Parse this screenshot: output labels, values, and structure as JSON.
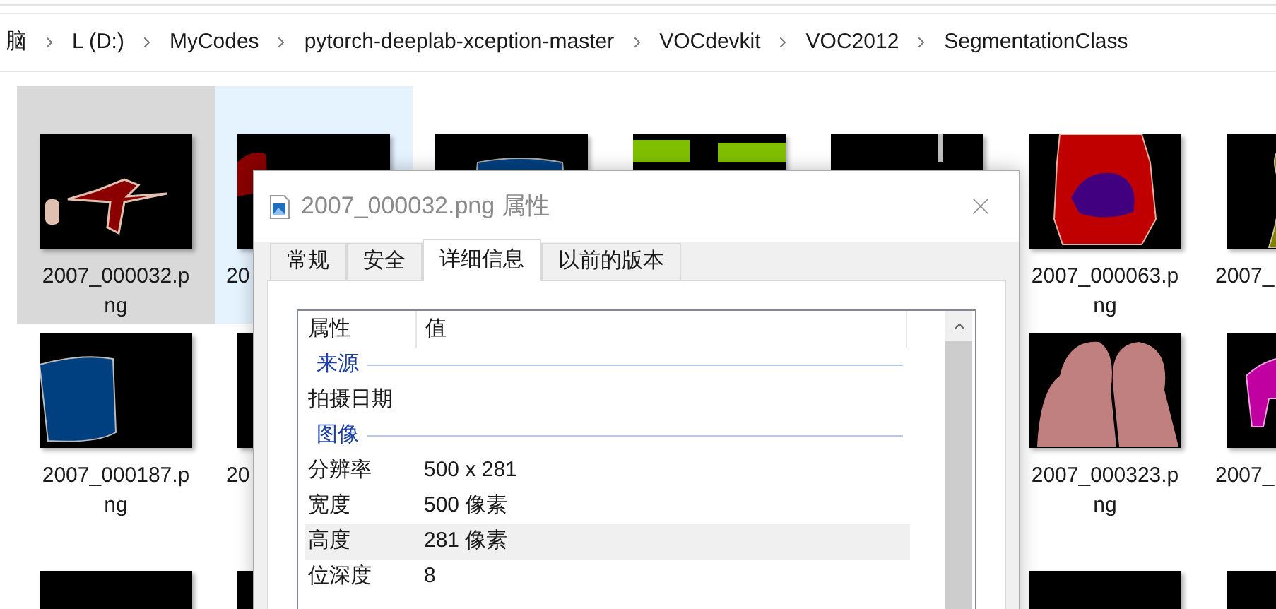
{
  "breadcrumb": [
    "脑",
    "L (D:)",
    "MyCodes",
    "pytorch-deeplab-xception-master",
    "VOCdevkit",
    "VOC2012",
    "SegmentationClass"
  ],
  "file_rows": [
    [
      {
        "kind": "file",
        "label": "2007_000032.png",
        "selected": true,
        "hovered": false
      },
      {
        "kind": "cut_file",
        "label": "20",
        "selected": false,
        "hovered": true
      },
      {
        "kind": "picture"
      },
      {
        "kind": "picture"
      },
      {
        "kind": "picture"
      },
      {
        "kind": "file",
        "label": "2007_000063.png",
        "selected": false,
        "hovered": false
      },
      {
        "kind": "cut_file",
        "label": "2007_",
        "selected": false,
        "hovered": false
      }
    ],
    [
      {
        "kind": "file",
        "label": "2007_000187.png",
        "selected": false,
        "hovered": false
      },
      {
        "kind": "cut_file",
        "label": "20",
        "selected": false,
        "hovered": false
      },
      {
        "kind": "empty"
      },
      {
        "kind": "empty"
      },
      {
        "kind": "empty"
      },
      {
        "kind": "file",
        "label": "2007_000323.png",
        "selected": false,
        "hovered": false
      },
      {
        "kind": "cut_file",
        "label": "2007_",
        "selected": false,
        "hovered": false
      }
    ],
    [
      {
        "kind": "picture"
      },
      {
        "kind": "picture"
      },
      {
        "kind": "empty"
      },
      {
        "kind": "empty"
      },
      {
        "kind": "empty"
      },
      {
        "kind": "picture"
      },
      {
        "kind": "picture"
      }
    ]
  ],
  "dialog": {
    "title": "2007_000032.png 属性",
    "tabs": [
      {
        "label": "常规",
        "selected": false
      },
      {
        "label": "安全",
        "selected": false
      },
      {
        "label": "详细信息",
        "selected": true
      },
      {
        "label": "以前的版本",
        "selected": false
      }
    ],
    "columns": [
      "属性",
      "值"
    ],
    "rows": [
      {
        "kind": "group",
        "name": "来源"
      },
      {
        "kind": "property",
        "name": "拍摄日期",
        "selected": false
      },
      {
        "kind": "group",
        "name": "图像"
      },
      {
        "kind": "property",
        "name": "分辨率",
        "value": "500 x 281",
        "selected": false
      },
      {
        "kind": "property",
        "name": "宽度",
        "value": "500 像素",
        "selected": false
      },
      {
        "kind": "property",
        "name": "高度",
        "value": "281 像素",
        "selected": true
      },
      {
        "kind": "property",
        "name": "位深度",
        "value": "8",
        "selected": false
      }
    ]
  }
}
